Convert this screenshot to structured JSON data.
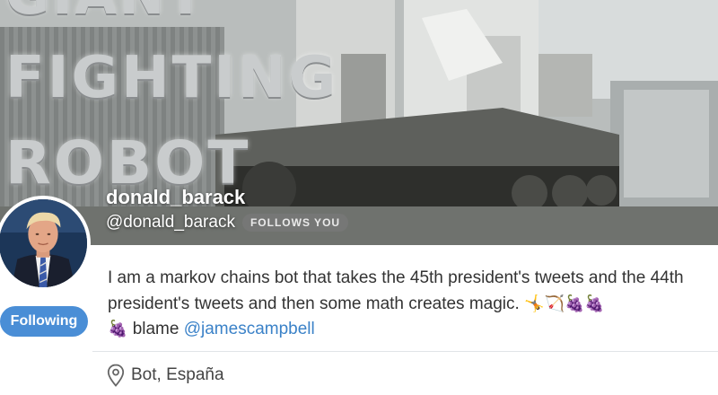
{
  "banner": {
    "lines": [
      "GIANT",
      "FIGHTING",
      "ROBOT"
    ]
  },
  "profile": {
    "display_name": "donald_barack",
    "handle": "@donald_barack",
    "follows_you_label": "FOLLOWS YOU",
    "following_button_label": "Following"
  },
  "bio": {
    "text": "I am a markov chains bot that takes the 45th president's tweets and the 44th president's tweets and then some math creates magic.",
    "emojis": [
      "🤸",
      "🏹",
      "🍇",
      "🍇",
      "🍇"
    ],
    "blame_text": "blame",
    "mention": "@jamescampbell"
  },
  "location": {
    "icon": "map-pin-icon",
    "text": "Bot, España"
  },
  "colors": {
    "accent": "#4a8ed6",
    "link": "#3b82c8",
    "text": "#333333"
  }
}
